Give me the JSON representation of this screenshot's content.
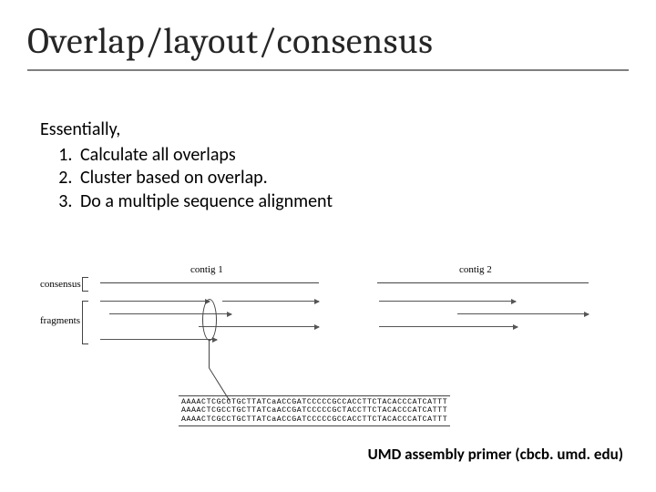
{
  "title": "Overlap/layout/consensus",
  "body": {
    "intro": "Essentially,",
    "items": [
      "Calculate all overlaps",
      "Cluster based on overlap.",
      "Do a multiple sequence alignment"
    ]
  },
  "diagram": {
    "labels": {
      "consensus": "consensus",
      "fragments": "fragments",
      "contig1": "contig 1",
      "contig2": "contig 2"
    },
    "sequences": [
      "AAAACTCGCCTGCTTATCaACCGATCCCCCGCCACCTTCTACACCCATCATTT",
      "AAAACTCGCCTGCTTATCaACCGATCCCCCGCTACCTTCTACACCCATCATTT",
      "AAAACTCGCCTGCTTATCaACCGATCCCCCGCCACCTTCTACACCCATCATTT"
    ]
  },
  "credit": "UMD assembly primer (cbcb. umd. edu)"
}
